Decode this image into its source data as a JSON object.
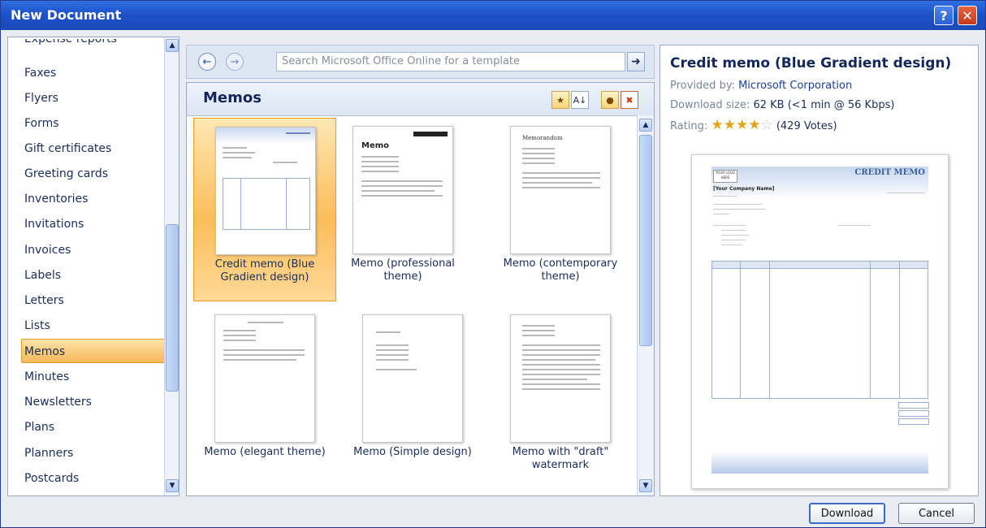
{
  "window": {
    "title": "New Document",
    "help_label": "?",
    "close_label": "✕"
  },
  "categories": [
    {
      "label": "Expense reports"
    },
    {
      "label": "Faxes"
    },
    {
      "label": "Flyers"
    },
    {
      "label": "Forms"
    },
    {
      "label": "Gift certificates"
    },
    {
      "label": "Greeting cards"
    },
    {
      "label": "Inventories"
    },
    {
      "label": "Invitations"
    },
    {
      "label": "Invoices"
    },
    {
      "label": "Labels"
    },
    {
      "label": "Letters"
    },
    {
      "label": "Lists"
    },
    {
      "label": "Memos",
      "selected": true
    },
    {
      "label": "Minutes"
    },
    {
      "label": "Newsletters"
    },
    {
      "label": "Plans"
    },
    {
      "label": "Planners"
    },
    {
      "label": "Postcards"
    }
  ],
  "search": {
    "placeholder": "Search Microsoft Office Online for a template",
    "back_icon": "←",
    "forward_icon": "→",
    "go_icon": "➜"
  },
  "gallery": {
    "title": "Memos",
    "templates": [
      {
        "caption": "Credit memo (Blue Gradient design)",
        "selected": true
      },
      {
        "caption": "Memo (professional theme)"
      },
      {
        "caption": "Memo (contemporary theme)"
      },
      {
        "caption": "Memo (elegant theme)"
      },
      {
        "caption": "Memo (Simple design)"
      },
      {
        "caption": "Memo with \"draft\" watermark"
      }
    ],
    "thumb_text": {
      "memo": "Memo",
      "memorandum": "Memorandum",
      "credit": "CREDIT MEMO"
    }
  },
  "details": {
    "title": "Credit memo (Blue Gradient design)",
    "provided_label": "Provided by:",
    "provided_value": "Microsoft Corporation",
    "size_label": "Download size:",
    "size_value": "62 KB (<1 min @ 56 Kbps)",
    "rating_label": "Rating:",
    "rating_stars": 4,
    "votes": "(429 Votes)",
    "preview": {
      "logo": "YOUR LOGO HERE",
      "heading": "CREDIT MEMO",
      "company": "[Your Company Name]"
    }
  },
  "buttons": {
    "download": "Download",
    "cancel": "Cancel"
  },
  "colors": {
    "title_bar": "#1d49b8",
    "selection": "#f9b85a",
    "link": "#1b3f9a"
  }
}
